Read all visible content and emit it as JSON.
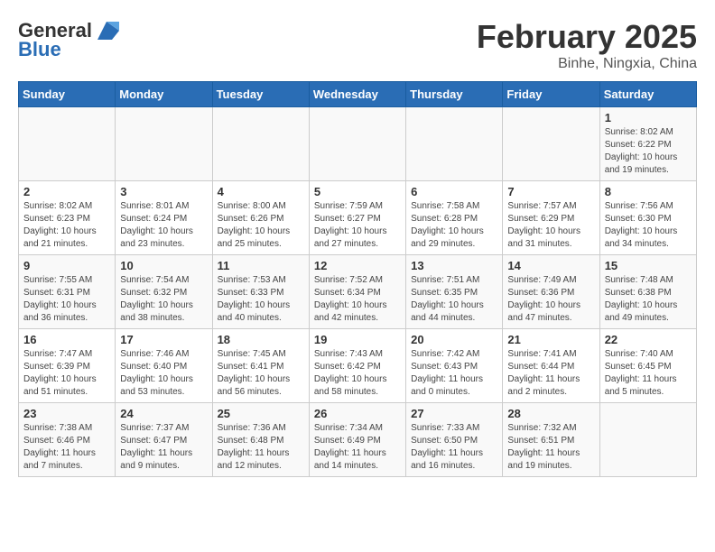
{
  "header": {
    "logo_general": "General",
    "logo_blue": "Blue",
    "title": "February 2025",
    "subtitle": "Binhe, Ningxia, China"
  },
  "weekdays": [
    "Sunday",
    "Monday",
    "Tuesday",
    "Wednesday",
    "Thursday",
    "Friday",
    "Saturday"
  ],
  "weeks": [
    [
      {
        "day": "",
        "info": ""
      },
      {
        "day": "",
        "info": ""
      },
      {
        "day": "",
        "info": ""
      },
      {
        "day": "",
        "info": ""
      },
      {
        "day": "",
        "info": ""
      },
      {
        "day": "",
        "info": ""
      },
      {
        "day": "1",
        "info": "Sunrise: 8:02 AM\nSunset: 6:22 PM\nDaylight: 10 hours\nand 19 minutes."
      }
    ],
    [
      {
        "day": "2",
        "info": "Sunrise: 8:02 AM\nSunset: 6:23 PM\nDaylight: 10 hours\nand 21 minutes."
      },
      {
        "day": "3",
        "info": "Sunrise: 8:01 AM\nSunset: 6:24 PM\nDaylight: 10 hours\nand 23 minutes."
      },
      {
        "day": "4",
        "info": "Sunrise: 8:00 AM\nSunset: 6:26 PM\nDaylight: 10 hours\nand 25 minutes."
      },
      {
        "day": "5",
        "info": "Sunrise: 7:59 AM\nSunset: 6:27 PM\nDaylight: 10 hours\nand 27 minutes."
      },
      {
        "day": "6",
        "info": "Sunrise: 7:58 AM\nSunset: 6:28 PM\nDaylight: 10 hours\nand 29 minutes."
      },
      {
        "day": "7",
        "info": "Sunrise: 7:57 AM\nSunset: 6:29 PM\nDaylight: 10 hours\nand 31 minutes."
      },
      {
        "day": "8",
        "info": "Sunrise: 7:56 AM\nSunset: 6:30 PM\nDaylight: 10 hours\nand 34 minutes."
      }
    ],
    [
      {
        "day": "9",
        "info": "Sunrise: 7:55 AM\nSunset: 6:31 PM\nDaylight: 10 hours\nand 36 minutes."
      },
      {
        "day": "10",
        "info": "Sunrise: 7:54 AM\nSunset: 6:32 PM\nDaylight: 10 hours\nand 38 minutes."
      },
      {
        "day": "11",
        "info": "Sunrise: 7:53 AM\nSunset: 6:33 PM\nDaylight: 10 hours\nand 40 minutes."
      },
      {
        "day": "12",
        "info": "Sunrise: 7:52 AM\nSunset: 6:34 PM\nDaylight: 10 hours\nand 42 minutes."
      },
      {
        "day": "13",
        "info": "Sunrise: 7:51 AM\nSunset: 6:35 PM\nDaylight: 10 hours\nand 44 minutes."
      },
      {
        "day": "14",
        "info": "Sunrise: 7:49 AM\nSunset: 6:36 PM\nDaylight: 10 hours\nand 47 minutes."
      },
      {
        "day": "15",
        "info": "Sunrise: 7:48 AM\nSunset: 6:38 PM\nDaylight: 10 hours\nand 49 minutes."
      }
    ],
    [
      {
        "day": "16",
        "info": "Sunrise: 7:47 AM\nSunset: 6:39 PM\nDaylight: 10 hours\nand 51 minutes."
      },
      {
        "day": "17",
        "info": "Sunrise: 7:46 AM\nSunset: 6:40 PM\nDaylight: 10 hours\nand 53 minutes."
      },
      {
        "day": "18",
        "info": "Sunrise: 7:45 AM\nSunset: 6:41 PM\nDaylight: 10 hours\nand 56 minutes."
      },
      {
        "day": "19",
        "info": "Sunrise: 7:43 AM\nSunset: 6:42 PM\nDaylight: 10 hours\nand 58 minutes."
      },
      {
        "day": "20",
        "info": "Sunrise: 7:42 AM\nSunset: 6:43 PM\nDaylight: 11 hours\nand 0 minutes."
      },
      {
        "day": "21",
        "info": "Sunrise: 7:41 AM\nSunset: 6:44 PM\nDaylight: 11 hours\nand 2 minutes."
      },
      {
        "day": "22",
        "info": "Sunrise: 7:40 AM\nSunset: 6:45 PM\nDaylight: 11 hours\nand 5 minutes."
      }
    ],
    [
      {
        "day": "23",
        "info": "Sunrise: 7:38 AM\nSunset: 6:46 PM\nDaylight: 11 hours\nand 7 minutes."
      },
      {
        "day": "24",
        "info": "Sunrise: 7:37 AM\nSunset: 6:47 PM\nDaylight: 11 hours\nand 9 minutes."
      },
      {
        "day": "25",
        "info": "Sunrise: 7:36 AM\nSunset: 6:48 PM\nDaylight: 11 hours\nand 12 minutes."
      },
      {
        "day": "26",
        "info": "Sunrise: 7:34 AM\nSunset: 6:49 PM\nDaylight: 11 hours\nand 14 minutes."
      },
      {
        "day": "27",
        "info": "Sunrise: 7:33 AM\nSunset: 6:50 PM\nDaylight: 11 hours\nand 16 minutes."
      },
      {
        "day": "28",
        "info": "Sunrise: 7:32 AM\nSunset: 6:51 PM\nDaylight: 11 hours\nand 19 minutes."
      },
      {
        "day": "",
        "info": ""
      }
    ]
  ]
}
